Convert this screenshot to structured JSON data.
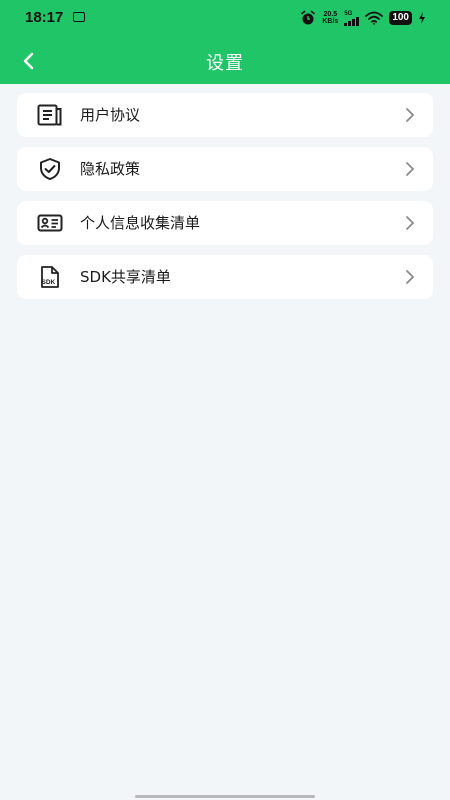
{
  "status_bar": {
    "time": "18:17",
    "net_speed_value": "20.5",
    "net_speed_unit": "KB/s",
    "network_type": "5G",
    "battery": "100"
  },
  "header": {
    "title": "设置"
  },
  "menu": {
    "items": [
      {
        "label": "用户协议",
        "icon": "document-icon"
      },
      {
        "label": "隐私政策",
        "icon": "shield-check-icon"
      },
      {
        "label": "个人信息收集清单",
        "icon": "id-card-icon"
      },
      {
        "label": "SDK共享清单",
        "icon": "sdk-file-icon",
        "icon_text": "SDK"
      }
    ]
  },
  "colors": {
    "header_green": "#1fc566",
    "background": "#f3f6f9",
    "card": "#ffffff",
    "text": "#1a1a1a",
    "chevron": "#8a8a8a"
  }
}
